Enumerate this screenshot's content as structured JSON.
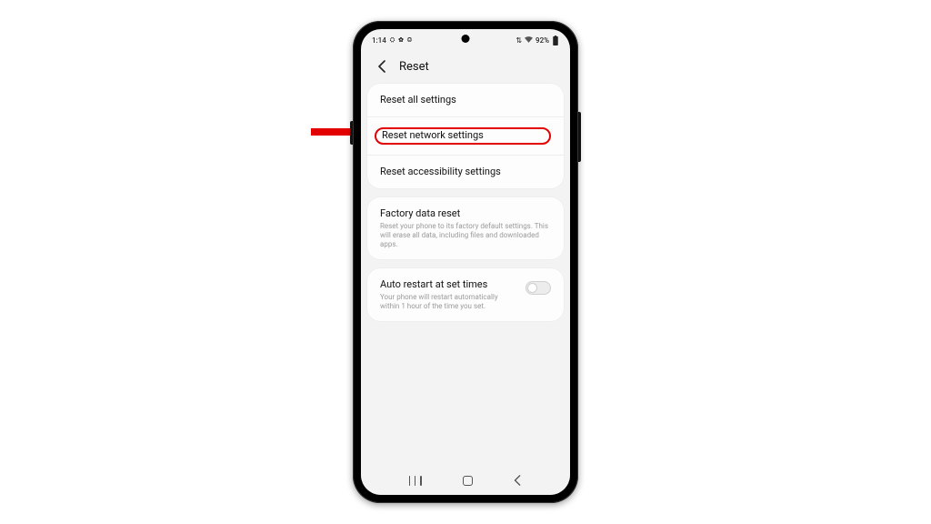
{
  "status": {
    "time": "1:14",
    "left_indicators": "⛭ ✿ ◎",
    "signal_text": "⇅",
    "wifi": "⊚",
    "battery_percent": "92%"
  },
  "header": {
    "back_icon": "chevron-left-icon",
    "title": "Reset"
  },
  "section_reset": {
    "items": [
      {
        "title": "Reset all settings"
      },
      {
        "title": "Reset network settings"
      },
      {
        "title": "Reset accessibility settings"
      }
    ]
  },
  "section_factory": {
    "title": "Factory data reset",
    "sub": "Reset your phone to its factory default settings. This will erase all data, including files and downloaded apps."
  },
  "section_auto_restart": {
    "title": "Auto restart at set times",
    "sub": "Your phone will restart automatically within 1 hour of the time you set.",
    "enabled_label": "off"
  },
  "annotations": {
    "highlighted_index": 1
  }
}
